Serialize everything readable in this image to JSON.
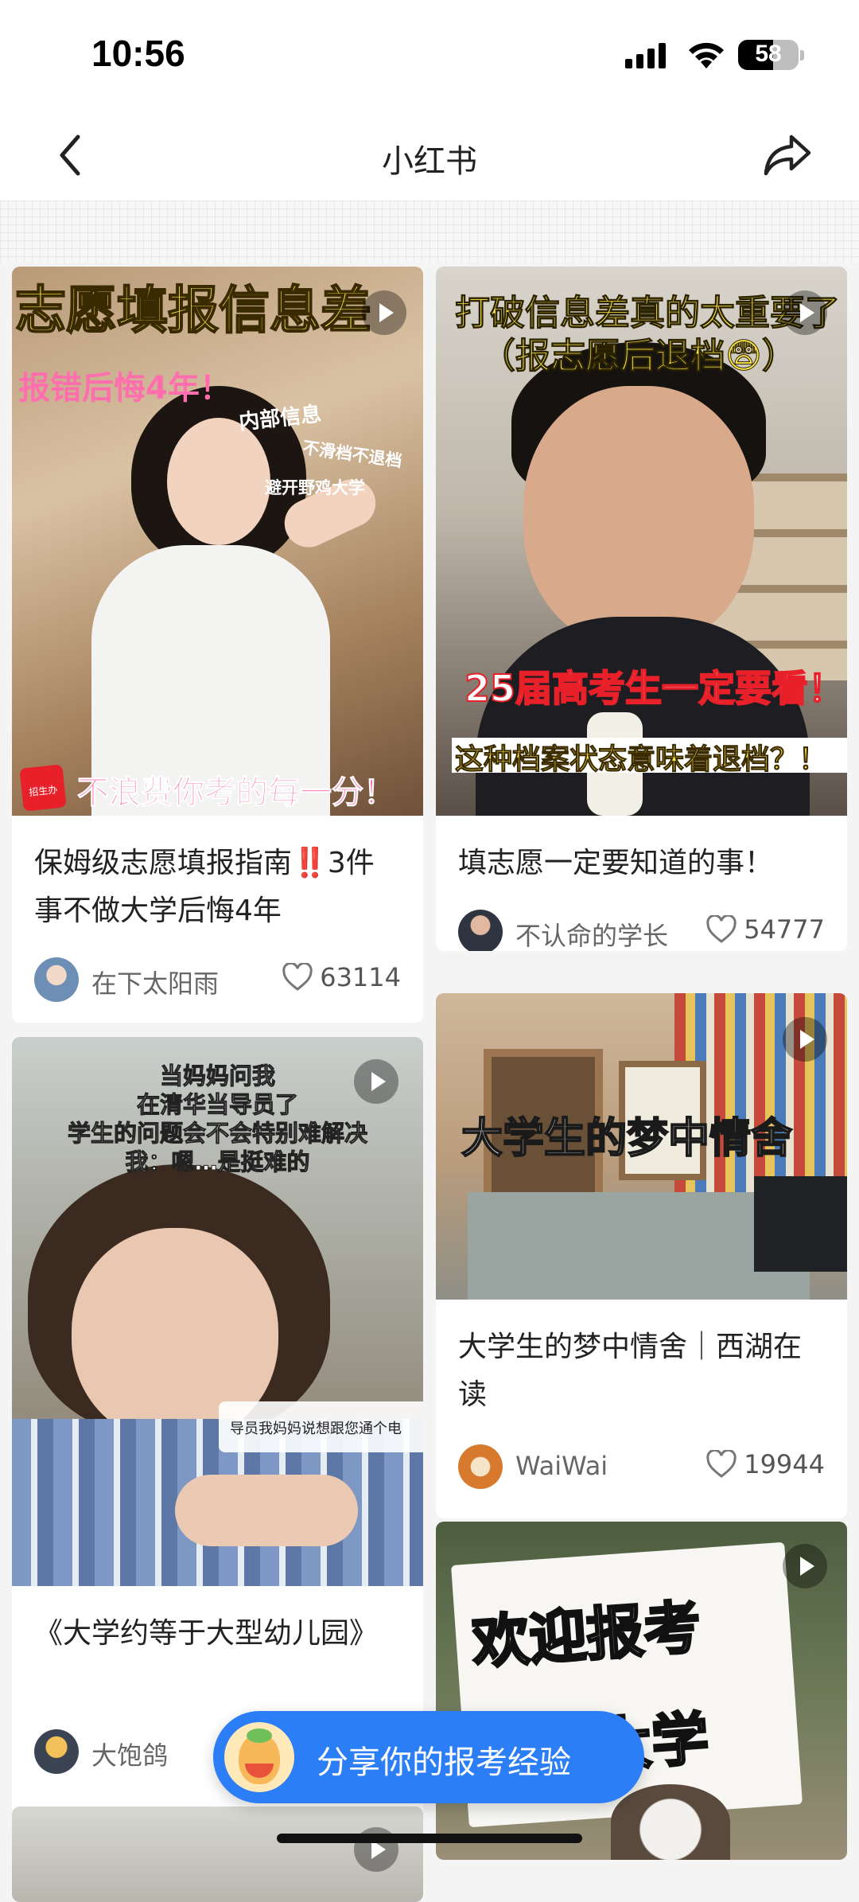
{
  "status_bar": {
    "time": "10:56",
    "battery": "58",
    "battery_level": 0.58
  },
  "nav": {
    "title": "小红书"
  },
  "feed": {
    "left": [
      {
        "overlay_top": "志愿填报信息差",
        "overlay_sub": "报错后悔4年！",
        "overlay_side": [
          "内部信息",
          "不滑档不退档",
          "避开野鸡大学"
        ],
        "overlay_logo": "招生办",
        "overlay_bottom": "不浪费你考的每一分！",
        "title": "保姆级志愿填报指南‼️3件事不做大学后悔4年",
        "author": "在下太阳雨",
        "likes": "63114"
      },
      {
        "overlay_lines": [
          "当妈妈问我",
          "在清华当导员了",
          "学生的问题会不会特别难解决",
          "我：嗯…是挺难的"
        ],
        "overlay_caption": "导员我妈妈说想跟您通个电",
        "title": "《大学约等于大型幼儿园》",
        "author": "大饱鸽",
        "likes": ""
      }
    ],
    "right": [
      {
        "overlay_top": "打破信息差真的太重要了",
        "overlay_sub": "（报志愿后退档😨）",
        "overlay_mid": "25届高考生一定要看！",
        "overlay_bottom": "这种档案状态意味着退档？！",
        "title": "填志愿一定要知道的事！",
        "author": "不认命的学长",
        "likes": "54777"
      },
      {
        "overlay_mid": "大学生的梦中情舍",
        "title": "大学生的梦中情舍｜西湖在读",
        "author": "WaiWai",
        "likes": "19944"
      },
      {
        "overlay_sign": [
          "欢迎报考",
          "武汉大学"
        ]
      }
    ]
  },
  "fab": {
    "label": "分享你的报考经验"
  },
  "colors": {
    "fab_blue": "#2b7ef6",
    "overlay_yellow": "#ffe94d",
    "overlay_red": "#e8202a",
    "overlay_pink": "#ff6fae"
  }
}
